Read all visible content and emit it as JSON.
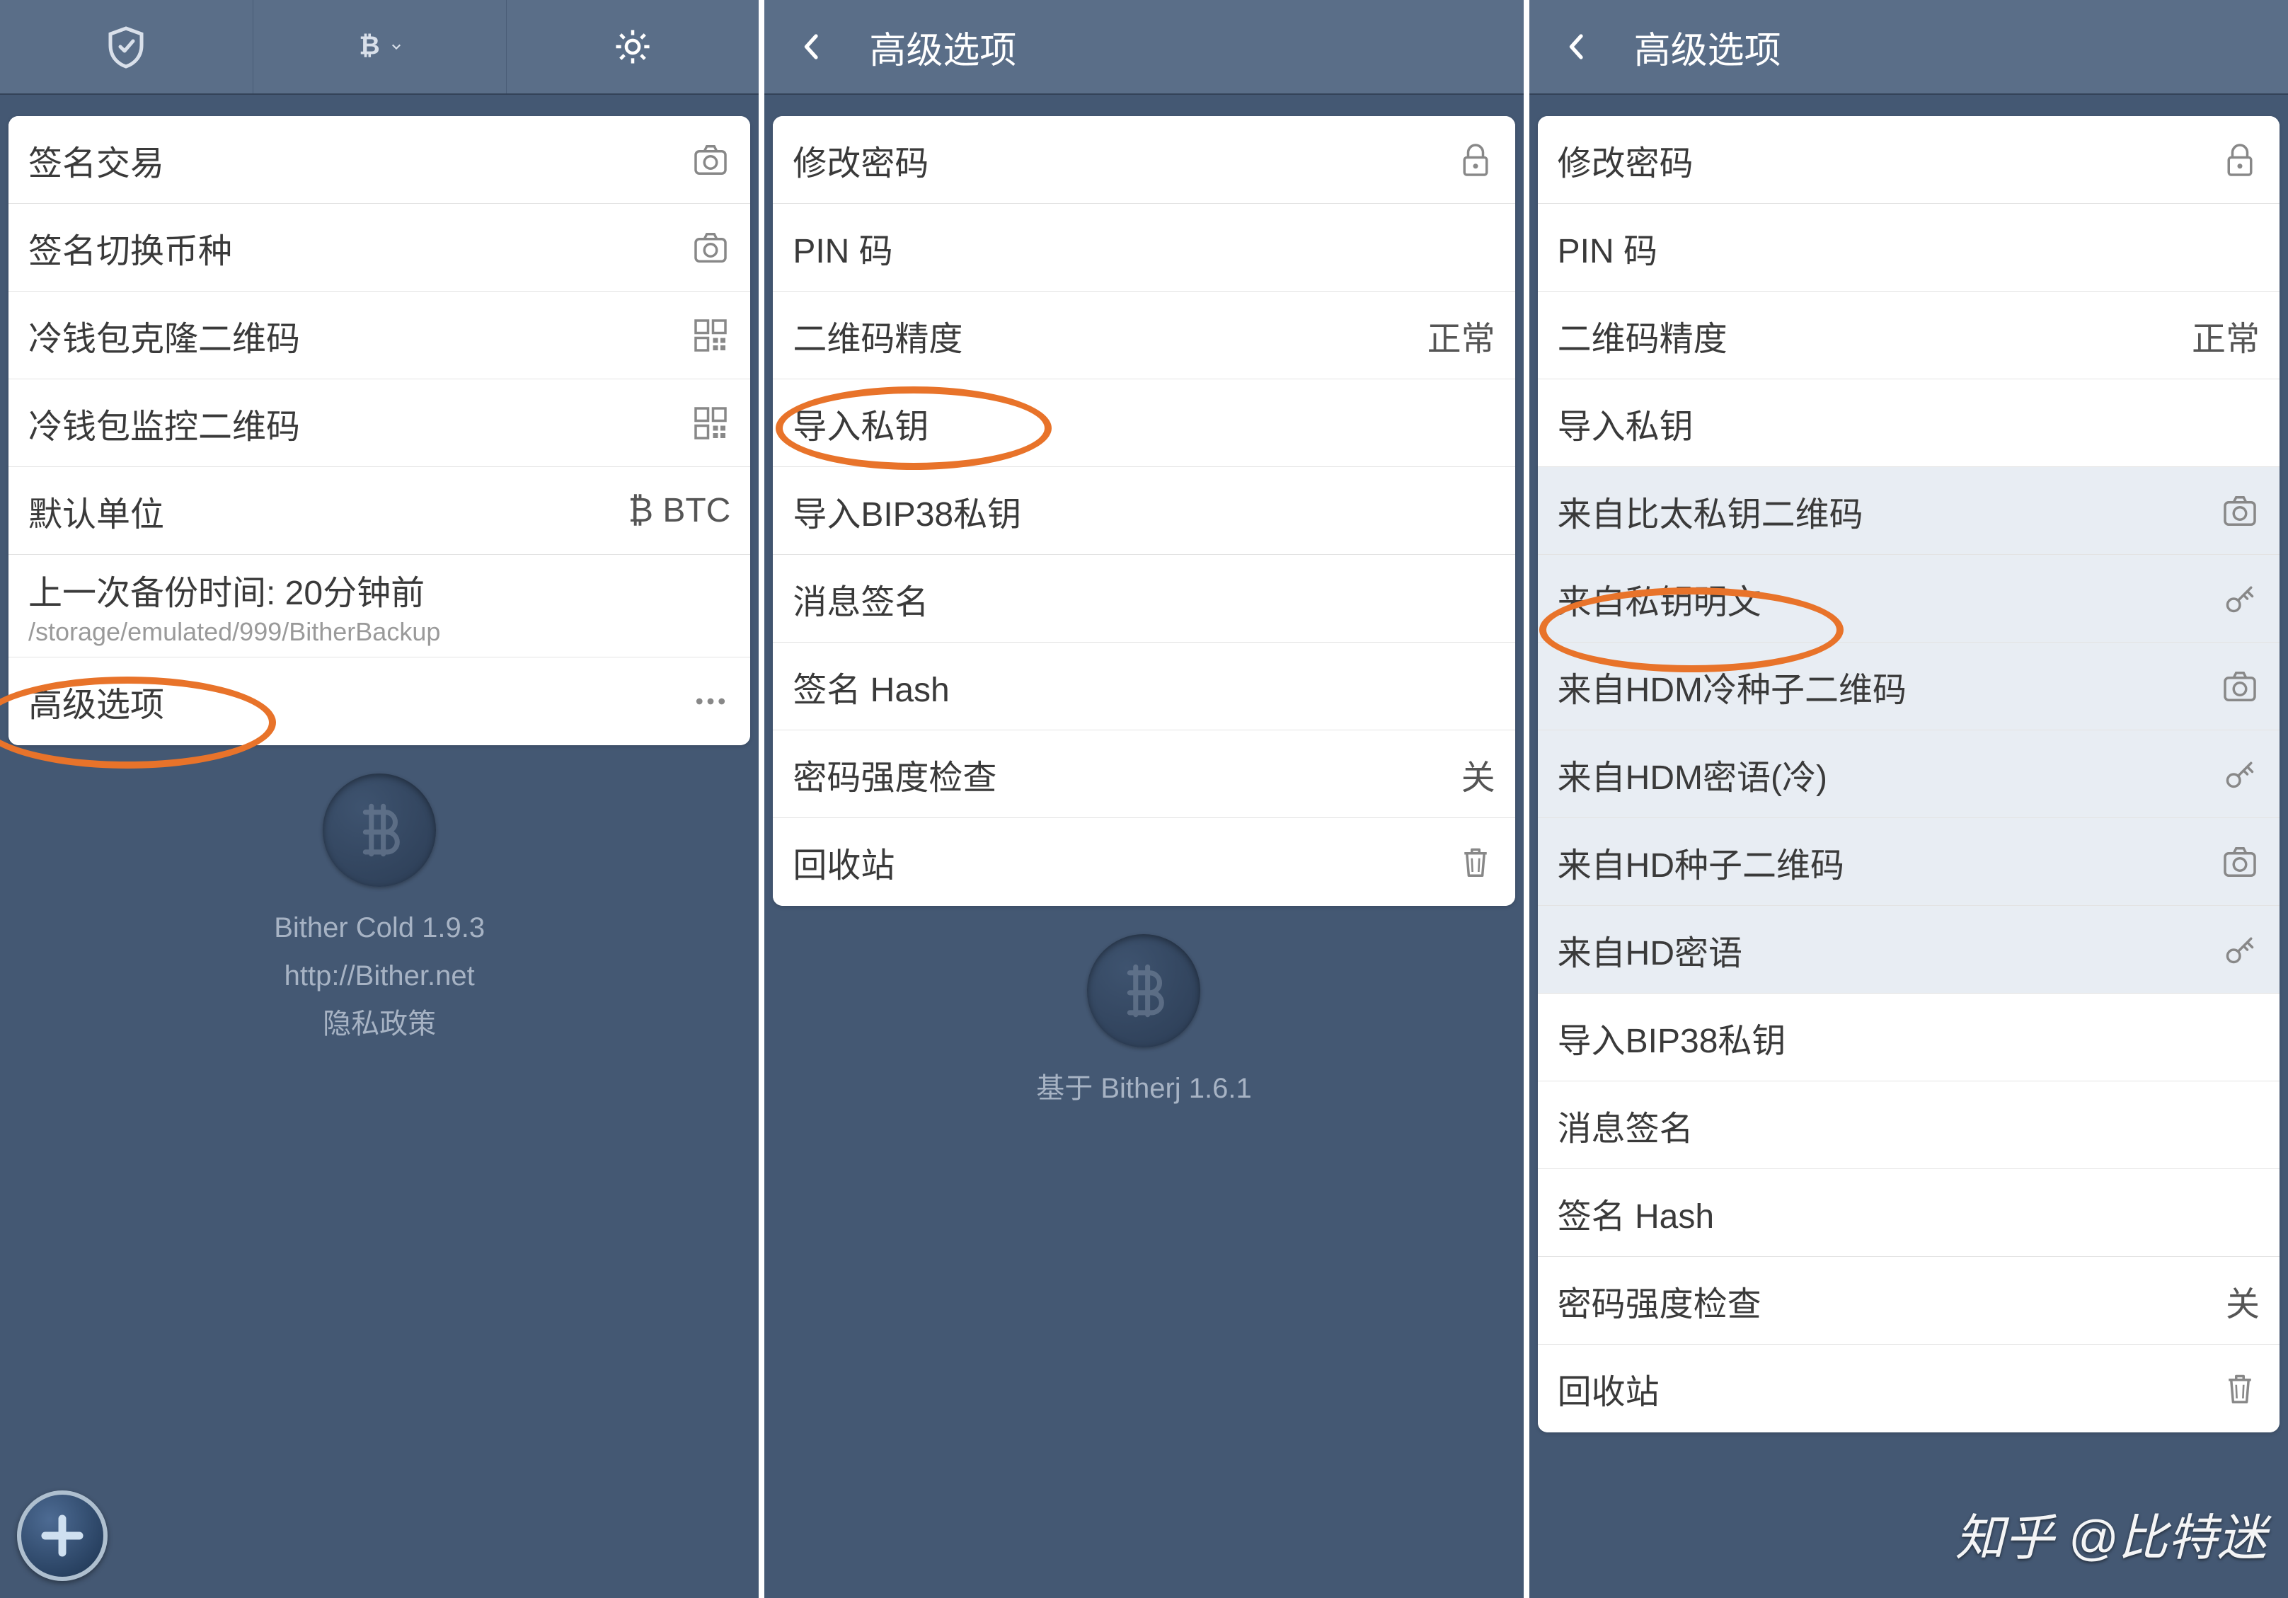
{
  "screen1": {
    "rows": [
      {
        "label": "签名交易",
        "icon": "camera"
      },
      {
        "label": "签名切换币种",
        "icon": "camera"
      },
      {
        "label": "冷钱包克隆二维码",
        "icon": "qr"
      },
      {
        "label": "冷钱包监控二维码",
        "icon": "qr"
      },
      {
        "label": "默认单位",
        "right": "₿ BTC"
      },
      {
        "label": "上一次备份时间: 20分钟前",
        "sublabel": "/storage/emulated/999/BitherBackup"
      },
      {
        "label": "高级选项",
        "icon": "dots"
      }
    ],
    "footer": {
      "line1": "Bither Cold 1.9.3",
      "line2": "http://Bither.net",
      "line3": "隐私政策"
    }
  },
  "screen2": {
    "title": "高级选项",
    "rows": [
      {
        "label": "修改密码",
        "icon": "lock"
      },
      {
        "label": "PIN 码"
      },
      {
        "label": "二维码精度",
        "right": "正常"
      },
      {
        "label": "导入私钥"
      },
      {
        "label": "导入BIP38私钥"
      },
      {
        "label": "消息签名"
      },
      {
        "label": "签名 Hash"
      },
      {
        "label": "密码强度检查",
        "right": "关"
      },
      {
        "label": "回收站",
        "icon": "trash"
      }
    ],
    "footer": {
      "line1": "基于 Bitherj 1.6.1"
    }
  },
  "screen3": {
    "title": "高级选项",
    "rows": [
      {
        "label": "修改密码",
        "icon": "lock"
      },
      {
        "label": "PIN 码"
      },
      {
        "label": "二维码精度",
        "right": "正常"
      },
      {
        "label": "导入私钥"
      },
      {
        "label": "来自比太私钥二维码",
        "icon": "camera",
        "sub": true
      },
      {
        "label": "来自私钥明文",
        "icon": "key",
        "sub": true
      },
      {
        "label": "来自HDM冷种子二维码",
        "icon": "camera",
        "sub": true
      },
      {
        "label": "来自HDM密语(冷)",
        "icon": "key",
        "sub": true
      },
      {
        "label": "来自HD种子二维码",
        "icon": "camera",
        "sub": true
      },
      {
        "label": "来自HD密语",
        "icon": "key",
        "sub": true
      },
      {
        "label": "导入BIP38私钥"
      },
      {
        "label": "消息签名"
      },
      {
        "label": "签名 Hash"
      },
      {
        "label": "密码强度检查",
        "right": "关"
      },
      {
        "label": "回收站",
        "icon": "trash"
      }
    ]
  },
  "watermark": "知乎 @比特迷"
}
